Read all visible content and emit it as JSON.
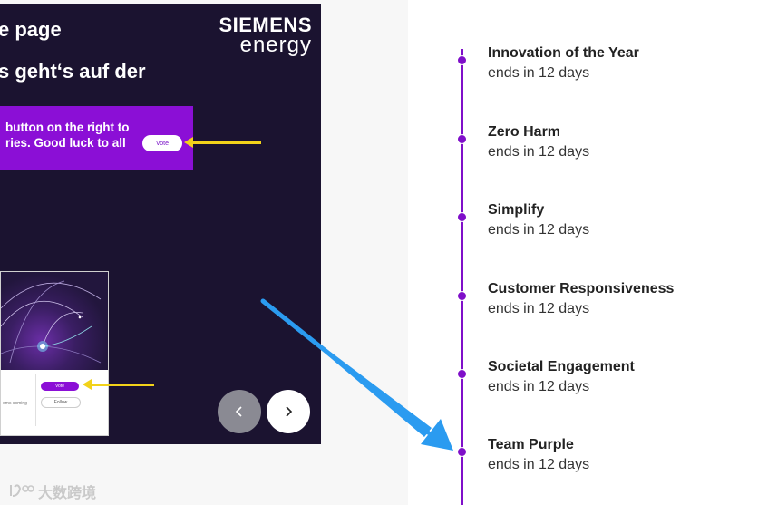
{
  "slide": {
    "title": "e page",
    "subtitle": "s geht‘s auf der",
    "logo_top": "SIEMENS",
    "logo_bottom": "energy",
    "banner_line1": "button on the right to",
    "banner_line2": "ries. Good luck to all",
    "banner_vote_label": "Vote",
    "mini_vote_label": "Vote",
    "mini_follow_label": "Follow",
    "mini_text": "oms coming"
  },
  "nav": {
    "prev_icon": "chevron-left-icon",
    "next_icon": "chevron-right-icon"
  },
  "timeline": {
    "items": [
      {
        "title": "Innovation of the Year",
        "status": "ends in 12 days"
      },
      {
        "title": "Zero Harm",
        "status": "ends in 12 days"
      },
      {
        "title": "Simplify",
        "status": "ends in 12 days"
      },
      {
        "title": "Customer Responsiveness",
        "status": "ends in 12 days"
      },
      {
        "title": "Societal Engagement",
        "status": "ends in 12 days"
      },
      {
        "title": "Team Purple",
        "status": "ends in 12 days"
      }
    ]
  },
  "watermark": {
    "text": "大数跨境"
  },
  "colors": {
    "accent_purple": "#7f0fc9",
    "slide_bg": "#1b1330",
    "annotation_yellow": "#f2d21a",
    "annotation_blue": "#2b9bf0"
  }
}
